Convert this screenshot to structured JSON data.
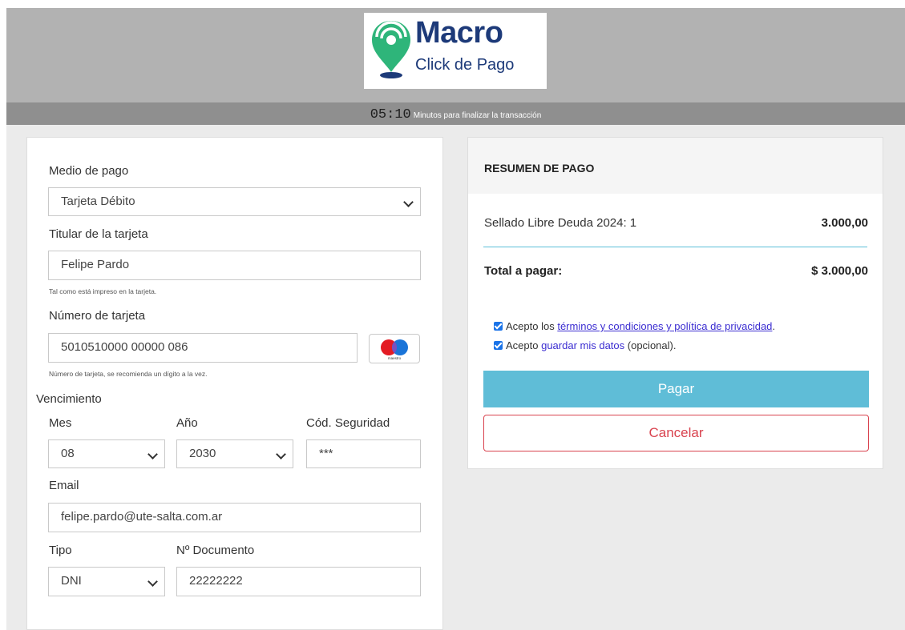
{
  "header": {
    "logo_title": "Macro",
    "logo_subtitle": "Click de Pago",
    "timer_value": "05:10",
    "timer_label": "Minutos para finalizar la transacción"
  },
  "form": {
    "payment_method_label": "Medio de pago",
    "payment_method_value": "Tarjeta Débito",
    "holder_label": "Titular de la tarjeta",
    "holder_value": "Felipe Pardo",
    "holder_hint": "Tal como está impreso en la tarjeta.",
    "card_number_label": "Número de tarjeta",
    "card_number_value": "5010510000 00000 086",
    "card_number_hint": "Número de tarjeta, se recomienda un dígito a la vez.",
    "card_brand": "maestro",
    "expiry_label": "Vencimiento",
    "month_label": "Mes",
    "month_value": "08",
    "year_label": "Año",
    "year_value": "2030",
    "cvv_label": "Cód. Seguridad",
    "cvv_value": "***",
    "email_label": "Email",
    "email_value": "felipe.pardo@ute-salta.com.ar",
    "doc_type_label": "Tipo",
    "doc_type_value": "DNI",
    "doc_number_label": "Nº Documento",
    "doc_number_value": "22222222"
  },
  "summary": {
    "title": "RESUMEN DE PAGO",
    "item_label": "Sellado Libre Deuda 2024: 1",
    "item_amount": "3.000,00",
    "total_label": "Total a pagar:",
    "total_value": "$ 3.000,00",
    "terms_prefix": "Acepto los ",
    "terms_link": "términos y condiciones y política de privacidad",
    "terms_suffix": ".",
    "save_prefix": "Acepto ",
    "save_link": "guardar mis datos",
    "save_suffix": " (opcional).",
    "pay_button": "Pagar",
    "cancel_button": "Cancelar"
  },
  "colors": {
    "brand_blue": "#1d3a79",
    "brand_green": "#2eb57a",
    "pay_button": "#5fbdd7",
    "cancel_red": "#d9434f",
    "link": "#3b2dd1"
  }
}
